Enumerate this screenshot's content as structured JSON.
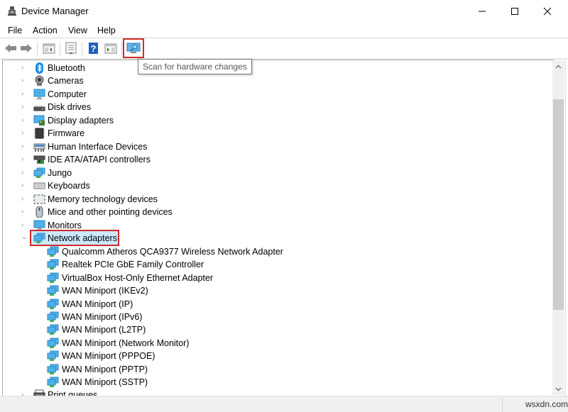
{
  "window": {
    "title": "Device Manager",
    "controls": {
      "minimize": "minimize",
      "maximize": "maximize",
      "close": "close"
    }
  },
  "menu": [
    "File",
    "Action",
    "View",
    "Help"
  ],
  "toolbar": {
    "buttons": [
      {
        "name": "back",
        "icon": "arrow-left-icon"
      },
      {
        "name": "forward",
        "icon": "arrow-right-icon"
      },
      {
        "name": "show-hide-console-tree",
        "icon": "console-tree-icon"
      },
      {
        "name": "properties",
        "icon": "properties-icon"
      },
      {
        "name": "help",
        "icon": "help-icon"
      },
      {
        "name": "show-hide-action-pane",
        "icon": "action-pane-icon"
      },
      {
        "name": "scan-for-hardware-changes",
        "icon": "monitor-scan-icon"
      }
    ],
    "tooltip": "Scan for hardware changes"
  },
  "tree": {
    "categories": [
      {
        "label": "Bluetooth",
        "icon": "bluetooth-icon",
        "expanded": false
      },
      {
        "label": "Cameras",
        "icon": "camera-icon",
        "expanded": false
      },
      {
        "label": "Computer",
        "icon": "computer-icon",
        "expanded": false
      },
      {
        "label": "Disk drives",
        "icon": "disk-drive-icon",
        "expanded": false
      },
      {
        "label": "Display adapters",
        "icon": "display-adapter-icon",
        "expanded": false
      },
      {
        "label": "Firmware",
        "icon": "firmware-icon",
        "expanded": false
      },
      {
        "label": "Human Interface Devices",
        "icon": "hid-icon",
        "expanded": false
      },
      {
        "label": "IDE ATA/ATAPI controllers",
        "icon": "ide-controller-icon",
        "expanded": false
      },
      {
        "label": "Jungo",
        "icon": "network-icon",
        "expanded": false
      },
      {
        "label": "Keyboards",
        "icon": "keyboard-icon",
        "expanded": false
      },
      {
        "label": "Memory technology devices",
        "icon": "memory-device-icon",
        "expanded": false
      },
      {
        "label": "Mice and other pointing devices",
        "icon": "mouse-icon",
        "expanded": false
      },
      {
        "label": "Monitors",
        "icon": "monitor-icon",
        "expanded": false
      },
      {
        "label": "Network adapters",
        "icon": "network-adapter-icon",
        "expanded": true,
        "selected": true
      }
    ],
    "network_adapters": [
      "Qualcomm Atheros QCA9377 Wireless Network Adapter",
      "Realtek PCIe GbE Family Controller",
      "VirtualBox Host-Only Ethernet Adapter",
      "WAN Miniport (IKEv2)",
      "WAN Miniport (IP)",
      "WAN Miniport (IPv6)",
      "WAN Miniport (L2TP)",
      "WAN Miniport (Network Monitor)",
      "WAN Miniport (PPPOE)",
      "WAN Miniport (PPTP)",
      "WAN Miniport (SSTP)"
    ],
    "after": [
      {
        "label": "Print queues",
        "icon": "printer-icon",
        "expanded": false
      }
    ]
  },
  "statusbar": {
    "watermark": "wsxdn.com"
  },
  "colors": {
    "highlight_border": "#d42a2a",
    "selection": "#cce8ff"
  }
}
